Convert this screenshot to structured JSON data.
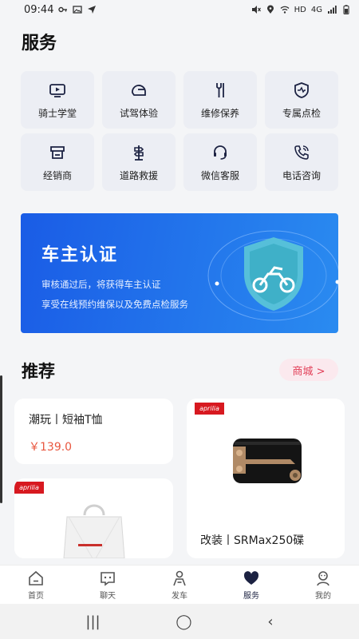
{
  "status_bar": {
    "time": "09:44",
    "network": "HD",
    "signal": "4G"
  },
  "page": {
    "title": "服务"
  },
  "services": [
    {
      "label": "骑士学堂",
      "icon": "tv-icon"
    },
    {
      "label": "试驾体验",
      "icon": "helmet-icon"
    },
    {
      "label": "维修保养",
      "icon": "wrench-icon"
    },
    {
      "label": "专属点检",
      "icon": "shield-check-icon"
    },
    {
      "label": "经销商",
      "icon": "store-icon"
    },
    {
      "label": "道路救援",
      "icon": "road-sign-icon"
    },
    {
      "label": "微信客服",
      "icon": "headset-icon"
    },
    {
      "label": "电话咨询",
      "icon": "phone-icon"
    }
  ],
  "banner": {
    "title": "车主认证",
    "line1": "审核通过后，将获得车主认证",
    "line2": "享受在线预约维保以及免费点检服务"
  },
  "recommend": {
    "title": "推荐",
    "mall_button": "商城 >",
    "cards": [
      {
        "name": "潮玩丨短袖T恤",
        "price": "￥139.0"
      },
      {
        "name": "改装丨SRMax250碟",
        "brand": "aprilia"
      },
      {
        "brand": "aprilia"
      }
    ]
  },
  "nav": [
    {
      "label": "首页",
      "icon": "home-icon"
    },
    {
      "label": "聊天",
      "icon": "chat-icon"
    },
    {
      "label": "发车",
      "icon": "rider-icon"
    },
    {
      "label": "服务",
      "icon": "heart-icon",
      "active": true
    },
    {
      "label": "我的",
      "icon": "profile-icon"
    }
  ],
  "colors": {
    "accent": "#e23e57",
    "price": "#e9573f",
    "banner_start": "#1a5ce6",
    "banner_end": "#2a8bf0",
    "nav_active": "#1c2242"
  }
}
